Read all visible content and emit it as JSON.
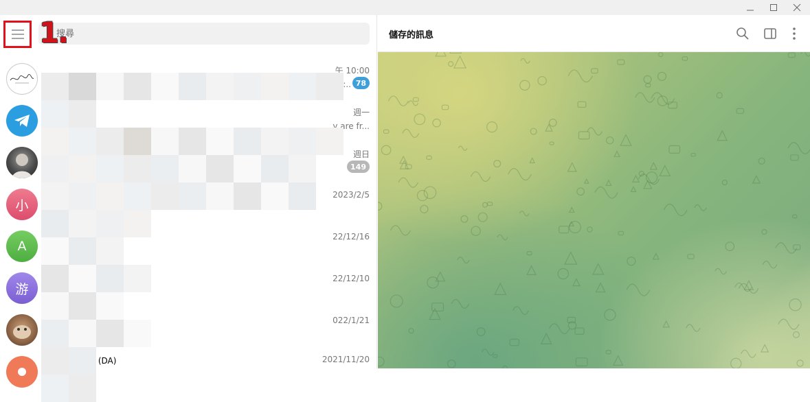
{
  "window": {
    "controls": [
      "minimize-icon",
      "maximize-icon",
      "close-icon"
    ]
  },
  "sidebar": {
    "menu_icon": "hamburger-icon",
    "step_marker": "1.",
    "search_placeholder": "搜尋",
    "chats": [
      {
        "avatar_type": "logo",
        "time": "午 10:00",
        "preview": "p:..",
        "badge": "78",
        "badge_muted": false
      },
      {
        "avatar_type": "telegram",
        "time": "週一",
        "preview": "y are fr...",
        "badge": "",
        "badge_muted": false
      },
      {
        "avatar_type": "photo",
        "time": "週日",
        "preview": "",
        "badge": "149",
        "badge_muted": true
      },
      {
        "avatar_type": "letter",
        "avatar_letter": "小",
        "avatar_color": "#e05a77",
        "time": "2023/2/5",
        "preview": "",
        "badge": ""
      },
      {
        "avatar_type": "letter",
        "avatar_letter": "A",
        "avatar_color": "#5dbb4f",
        "time": "22/12/16",
        "preview": "",
        "badge": ""
      },
      {
        "avatar_type": "letter",
        "avatar_letter": "游",
        "avatar_color": "#8a6fdb",
        "time": "22/12/10",
        "preview": "",
        "badge": ""
      },
      {
        "avatar_type": "photo2",
        "time": "022/1/21",
        "preview": "",
        "badge": ""
      },
      {
        "avatar_type": "deleted",
        "avatar_color": "#f07a57",
        "name": "已刪除的帳戶 (DA)",
        "time": "2021/11/20",
        "preview": "",
        "badge": ""
      }
    ]
  },
  "main": {
    "title": "儲存的訊息",
    "icons": [
      "search-icon",
      "sidebar-toggle-icon",
      "more-vertical-icon"
    ]
  },
  "colors": {
    "accent": "#3f9fdb",
    "highlight": "#e0111a",
    "badge_muted": "#b7b7b7"
  }
}
